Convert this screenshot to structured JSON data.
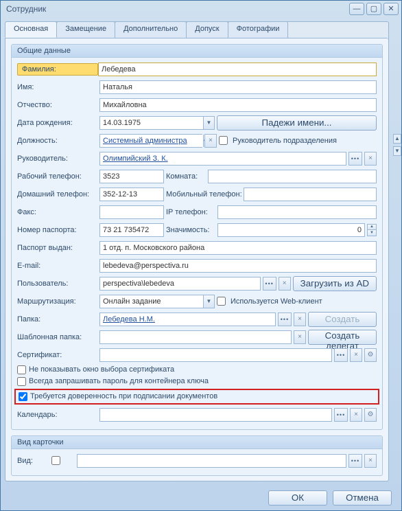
{
  "window": {
    "title": "Сотрудник"
  },
  "tabs": [
    "Основная",
    "Замещение",
    "Дополнительно",
    "Допуск",
    "Фотографии"
  ],
  "activeTab": 0,
  "group1": {
    "title": "Общие данные"
  },
  "group2": {
    "title": "Вид карточки"
  },
  "labels": {
    "surname": "Фамилия:",
    "name": "Имя:",
    "patronymic": "Отчество:",
    "birthdate": "Дата рождения:",
    "position": "Должность:",
    "manager": "Руководитель:",
    "workphone": "Рабочий телефон:",
    "room": "Комната:",
    "homephone": "Домашний телефон:",
    "mobile": "Мобильный телефон:",
    "fax": "Факс:",
    "ipphone": "IP телефон:",
    "passportNo": "Номер паспорта:",
    "importance": "Значимость:",
    "passportBy": "Паспорт выдан:",
    "email": "E-mail:",
    "user": "Пользователь:",
    "routing": "Маршрутизация:",
    "folder": "Папка:",
    "tplFolder": "Шаблонная папка:",
    "cert": "Сертификат:",
    "calendar": "Календарь:",
    "kind": "Вид:",
    "cases": "Падежи имени...",
    "headOf": "Руководитель подразделения",
    "loadAD": "Загрузить из AD",
    "useWeb": "Используется Web-клиент",
    "create": "Создать",
    "createDelegate": "Создать делегат",
    "noCertDlg": "Не показывать окно выбора сертификата",
    "askKeyPwd": "Всегда запрашивать пароль для контейнера ключа",
    "needProxy": "Требуется доверенность при подписании документов",
    "ok": "ОК",
    "cancel": "Отмена"
  },
  "values": {
    "surname": "Лебедева",
    "name": "Наталья",
    "patronymic": "Михайловна",
    "birthdate": "14.03.1975",
    "position": "Системный администра",
    "manager": "Олимпийский З. К.",
    "workphone": "3523",
    "room": "",
    "homephone": "352-12-13",
    "mobile": "",
    "fax": "",
    "ipphone": "",
    "passportNo": "73 21 735472",
    "importance": "0",
    "passportBy": "1 отд. п. Московского района",
    "email": "lebedeva@perspectiva.ru",
    "user": "perspectiva\\lebedeva",
    "routing": "Онлайн задание",
    "folder": "Лебедева Н.М.",
    "tplFolder": "",
    "cert": "",
    "calendar": "",
    "kind": ""
  },
  "checks": {
    "headOf": false,
    "useWeb": false,
    "noCertDlg": false,
    "askKeyPwd": false,
    "needProxy": true,
    "kindBox": false
  }
}
